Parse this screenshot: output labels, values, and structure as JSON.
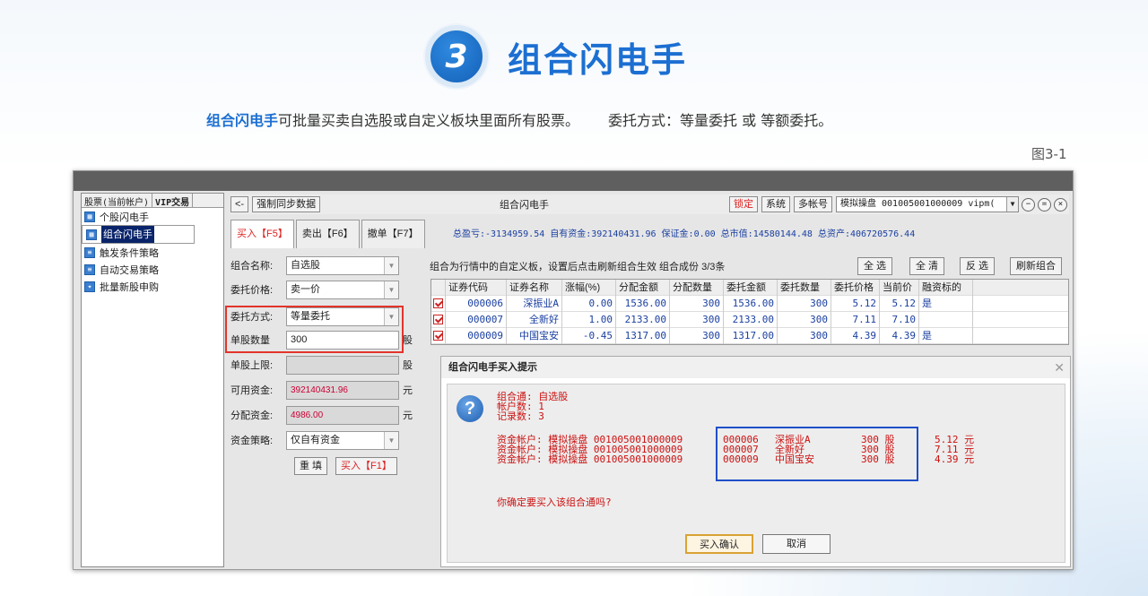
{
  "header": {
    "number": "3",
    "title": "组合闪电手"
  },
  "intro": {
    "highlight": "组合闪电手",
    "text": "可批量买卖自选股或自定义板块里面所有股票。",
    "method": "委托方式：等量委托 或 等额委托。"
  },
  "figure_label": "图3-1",
  "left_panel": {
    "tabs": [
      "股票(当前帐户)",
      "VIP交易"
    ],
    "items": [
      "个股闪电手",
      "组合闪电手",
      "触发条件策略",
      "自动交易策略",
      "批量新股申购"
    ],
    "selected": "组合闪电手"
  },
  "toolbar": {
    "back": "<-",
    "sync": "强制同步数据",
    "title": "组合闪电手",
    "lock": "锁定",
    "system": "系统",
    "multi_account": "多帐号",
    "account": "模拟操盘 001005001000009 vipm("
  },
  "order_tabs": [
    "买入【F5】",
    "卖出【F6】",
    "撤单【F7】"
  ],
  "summary": "总盈亏:-3134959.54  自有资金:392140431.96  保证金:0.00  总市值:14580144.48  总资产:406720576.44",
  "form": {
    "portfolio_label": "组合名称:",
    "portfolio": "自选股",
    "price_label": "委托价格:",
    "price": "卖一价",
    "method_label": "委托方式:",
    "method": "等量委托",
    "qty_label": "单股数量",
    "qty": "300",
    "qty_unit": "股",
    "limit_label": "单股上限:",
    "limit": "",
    "limit_unit": "股",
    "avail_label": "可用资金:",
    "avail": "392140431.96",
    "avail_unit": "元",
    "alloc_label": "分配资金:",
    "alloc": "4986.00",
    "alloc_unit": "元",
    "strategy_label": "资金策略:",
    "strategy": "仅自有资金",
    "reset": "重 填",
    "buy": "买入【F1】"
  },
  "grid": {
    "hint": "组合为行情中的自定义板，设置后点击刷新组合生效  组合成份 3/3条",
    "buttons": [
      "全 选",
      "全 清",
      "反 选",
      "刷新组合"
    ],
    "headers": [
      "证券代码",
      "证券名称",
      "涨幅(%)",
      "分配金额",
      "分配数量",
      "委托金额",
      "委托数量",
      "委托价格",
      "当前价",
      "融资标的"
    ],
    "rows": [
      [
        "000006",
        "深振业A",
        "0.00",
        "1536.00",
        "300",
        "1536.00",
        "300",
        "5.12",
        "5.12",
        "是"
      ],
      [
        "000007",
        "全新好",
        "1.00",
        "2133.00",
        "300",
        "2133.00",
        "300",
        "7.11",
        "7.10",
        ""
      ],
      [
        "000009",
        "中国宝安",
        "-0.45",
        "1317.00",
        "300",
        "1317.00",
        "300",
        "4.39",
        "4.39",
        "是"
      ]
    ]
  },
  "dialog": {
    "title": "组合闪电手买入提示",
    "info": [
      "组合通: 自选股",
      "帐户数: 1",
      "记录数: 3"
    ],
    "lines": [
      {
        "acct": "资金帐户: 模拟操盘 001005001000009",
        "code": "000006",
        "name": "深振业A",
        "qty": "300 股",
        "price": "5.12 元"
      },
      {
        "acct": "资金帐户: 模拟操盘 001005001000009",
        "code": "000007",
        "name": "全新好",
        "qty": "300 股",
        "price": "7.11 元"
      },
      {
        "acct": "资金帐户: 模拟操盘 001005001000009",
        "code": "000009",
        "name": "中国宝安",
        "qty": "300 股",
        "price": "4.39 元"
      }
    ],
    "confirm": "你确定要买入该组合通吗?",
    "ok": "买入确认",
    "cancel": "取消"
  }
}
